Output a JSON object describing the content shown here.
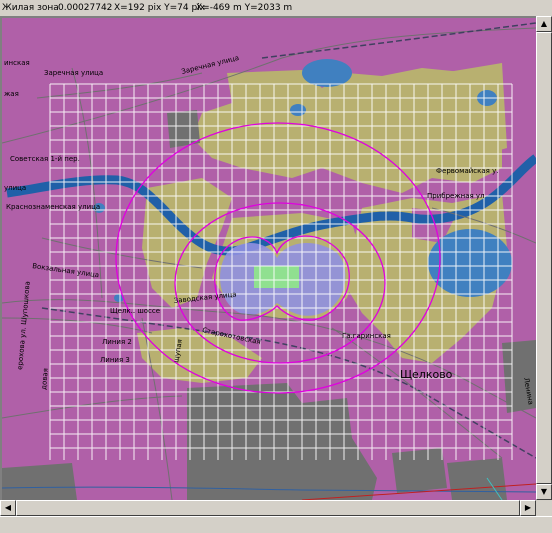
{
  "status": {
    "zone_label": "Жилая зона",
    "zone_value": "0.00027742",
    "pix_coords": "X=192 pix Y=74 pix",
    "map_coords": "X=-469 m Y=2033 m"
  },
  "map": {
    "colors": {
      "residential": "#b060a8",
      "industrial": "#b8b070",
      "river": "#2060a8",
      "lake": "#4080c0",
      "forest": "#6c8c4c",
      "gray_zone": "#707070",
      "grid": "#ffffff",
      "isoline": "#e000e0"
    },
    "streets": {
      "zarechnaya_1": "Заречная улица",
      "zarechnaya_2": "Заречная улица",
      "inskaya": "инская",
      "zhaya": "жая",
      "sovetskaya": "Советская 1-й пер.",
      "ulitsa": "улица",
      "krasnoznamenskaya": "Краснознаменская улица",
      "vokzalnaya": "Вокзальная улица",
      "zavodskaya": "Заводская улица",
      "shchelok": "Щелк.. шоссе",
      "liniya2": "Линия 2",
      "liniya3": "Линия 3",
      "starokhotovskaya": "Старохотовская",
      "shchupaya": "щупая",
      "shuposhkova": "ерохова ул. Шупошкова",
      "dovaya": "довая",
      "pribrezhnaya": "Прибрежная ул",
      "pervomaiskaya": "Фервомайская у.",
      "gaginskaya": "Га.гаринская",
      "lenina": "Ленина"
    },
    "town": "Щелково"
  }
}
